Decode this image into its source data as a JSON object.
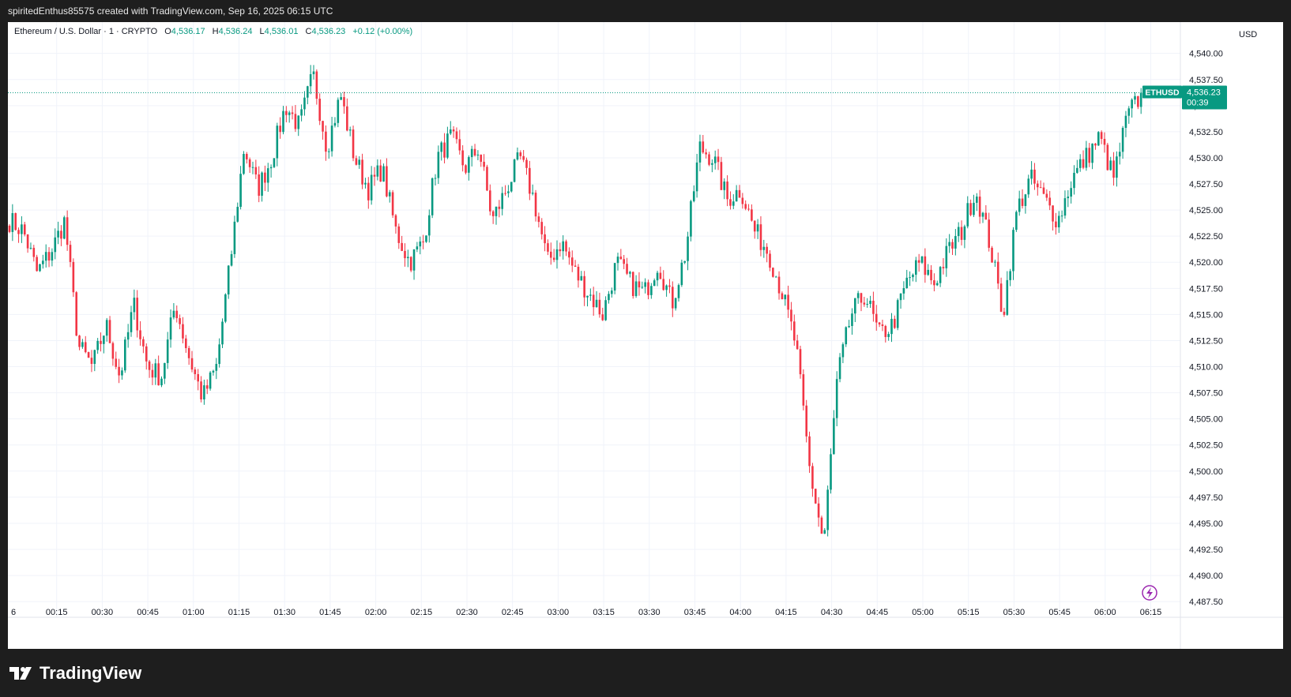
{
  "header": {
    "attribution": "spiritedEnthus85575 created with TradingView.com, Sep 16, 2025 06:15 UTC"
  },
  "legend": {
    "symbol": "Ethereum / U.S. Dollar · 1 · CRYPTO",
    "o_label": "O",
    "o_value": "4,536.17",
    "h_label": "H",
    "h_value": "4,536.24",
    "l_label": "L",
    "l_value": "4,536.01",
    "c_label": "C",
    "c_value": "4,536.23",
    "change": "+0.12 (+0.00%)"
  },
  "price_axis": {
    "currency": "USD"
  },
  "price_tag": {
    "symbol": "ETHUSD",
    "price": "4,536.23",
    "countdown": "00:39"
  },
  "brand": {
    "name": "TradingView"
  },
  "colors": {
    "up": "#089981",
    "down": "#f23645",
    "grid": "#f0f3fa",
    "text": "#131722",
    "background": "#ffffff",
    "frame": "#1e1e1e"
  },
  "chart_data": {
    "type": "candlestick",
    "symbol": "ETHUSD",
    "interval": "1m",
    "ylim": [
      4486,
      4543
    ],
    "y_ticks": [
      "4,487.50",
      "4,490.00",
      "4,492.50",
      "4,495.00",
      "4,497.50",
      "4,500.00",
      "4,502.50",
      "4,505.00",
      "4,507.50",
      "4,510.00",
      "4,512.50",
      "4,515.00",
      "4,517.50",
      "4,520.00",
      "4,522.50",
      "4,525.00",
      "4,527.50",
      "4,530.00",
      "4,532.50",
      "4,535.00",
      "4,537.50",
      "4,540.00"
    ],
    "x_ticks": [
      "6",
      "00:15",
      "00:30",
      "00:45",
      "01:00",
      "01:15",
      "01:30",
      "01:45",
      "02:00",
      "02:15",
      "02:30",
      "02:45",
      "03:00",
      "03:15",
      "03:30",
      "03:45",
      "04:00",
      "04:15",
      "04:30",
      "04:45",
      "05:00",
      "05:15",
      "05:30",
      "05:45",
      "06:00",
      "06:15"
    ],
    "last_price": 4536.23,
    "close_path": [
      4524,
      4523,
      4519,
      4521,
      4524,
      4512,
      4510,
      4514,
      4509,
      4516,
      4510,
      4509,
      4516,
      4511,
      4507,
      4510,
      4520,
      4531,
      4527,
      4530,
      4535,
      4533,
      4538,
      4531,
      4536,
      4530,
      4527,
      4529,
      4523,
      4520,
      4522,
      4530,
      4532,
      4529,
      4531,
      4524,
      4527,
      4530,
      4526,
      4520,
      4522,
      4519,
      4517,
      4515,
      4520,
      4518,
      4517,
      4520,
      4516,
      4521,
      4531,
      4530,
      4526,
      4527,
      4523,
      4521,
      4517,
      4512,
      4500,
      4493,
      4509,
      4515,
      4517,
      4513,
      4514,
      4518,
      4520,
      4518,
      4521,
      4523,
      4527,
      4522,
      4515,
      4525,
      4528,
      4526,
      4524,
      4528,
      4530,
      4532,
      4528,
      4534,
      4536
    ]
  }
}
